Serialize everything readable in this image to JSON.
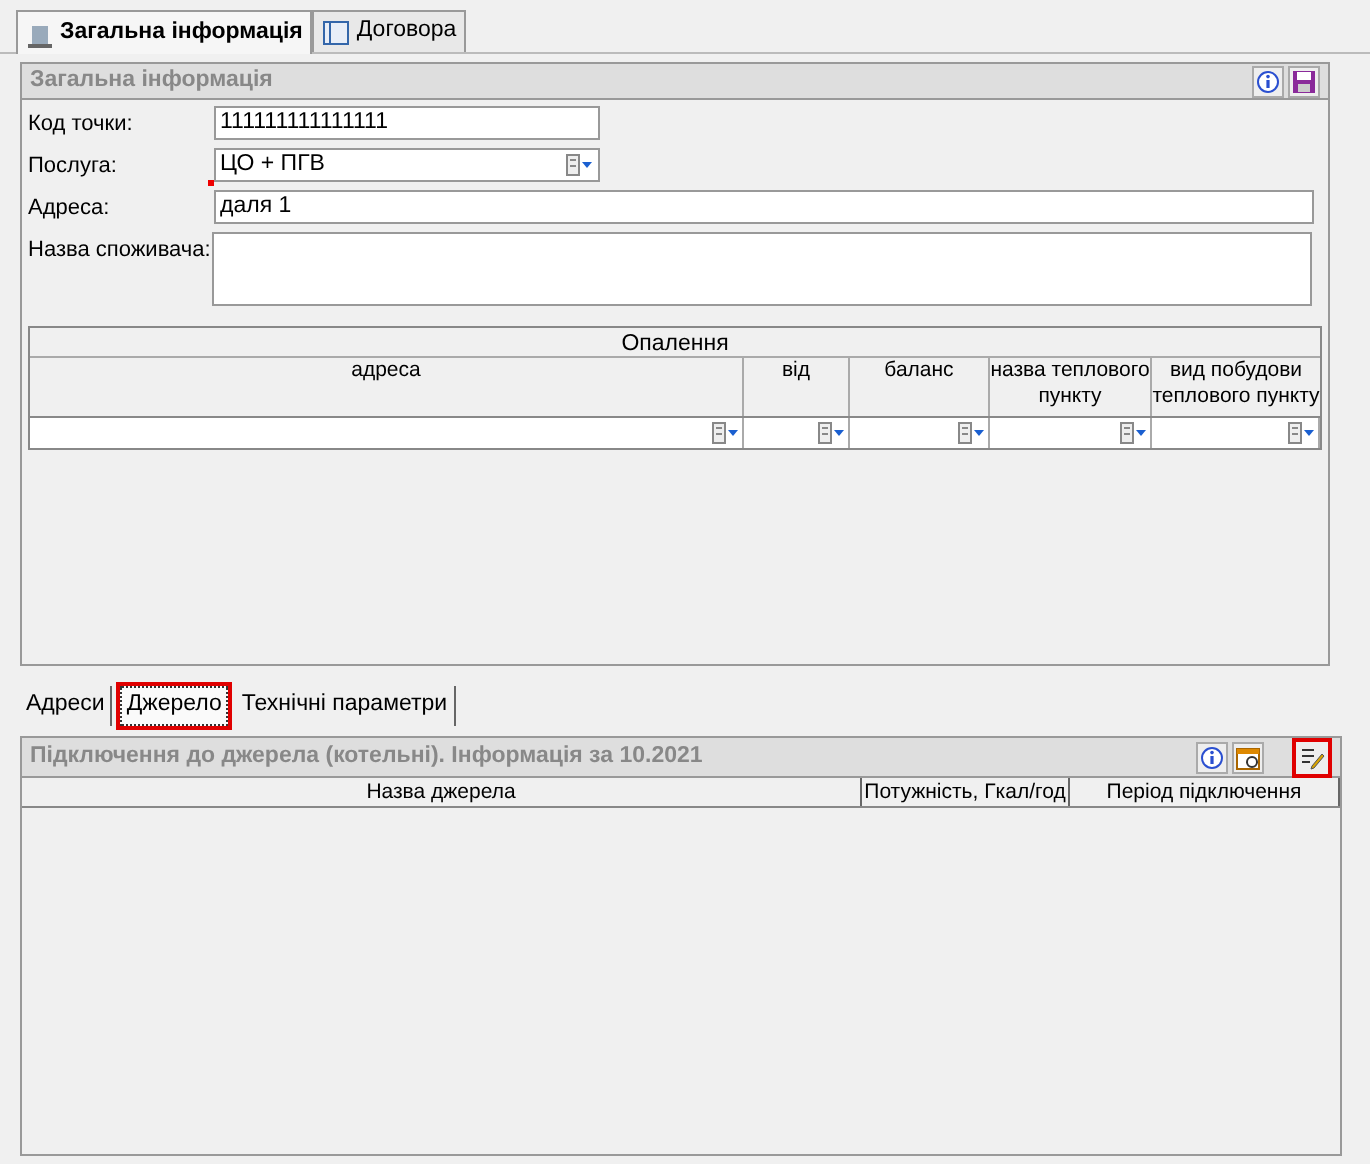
{
  "tabs": [
    {
      "label": "Загальна інформація",
      "selected": true
    },
    {
      "label": "Договора",
      "selected": false
    }
  ],
  "general_panel": {
    "title": "Загальна інформація",
    "fields": [
      {
        "label": "Код точки:",
        "value": "111111111111111",
        "kind": "text"
      },
      {
        "label": "Послуга:",
        "value": "ЦО + ПГВ",
        "kind": "combo"
      },
      {
        "label": "Адреса:",
        "value": "даля 1",
        "kind": "text",
        "required": true
      },
      {
        "label": "Назва споживача:",
        "kind": "memo"
      }
    ],
    "heating_table": {
      "title": "Опалення",
      "columns": [
        "адреса",
        "від",
        "баланс",
        "назва теплового пункту",
        "вид побудови теплового пункту"
      ]
    }
  },
  "subtabs": [
    {
      "label": "Адреси",
      "selected": false,
      "highlighted": false
    },
    {
      "label": "Джерело",
      "selected": true,
      "highlighted": true
    },
    {
      "label": "Технічні параметри",
      "selected": false,
      "highlighted": false
    }
  ],
  "source_panel": {
    "title": "Підключення до джерела (котельні). Інформація за 10.2021",
    "edit_button": {
      "highlighted": true
    },
    "columns": [
      "Назва джерела",
      "Потужність, Гкал/год",
      "Період підключення"
    ]
  }
}
